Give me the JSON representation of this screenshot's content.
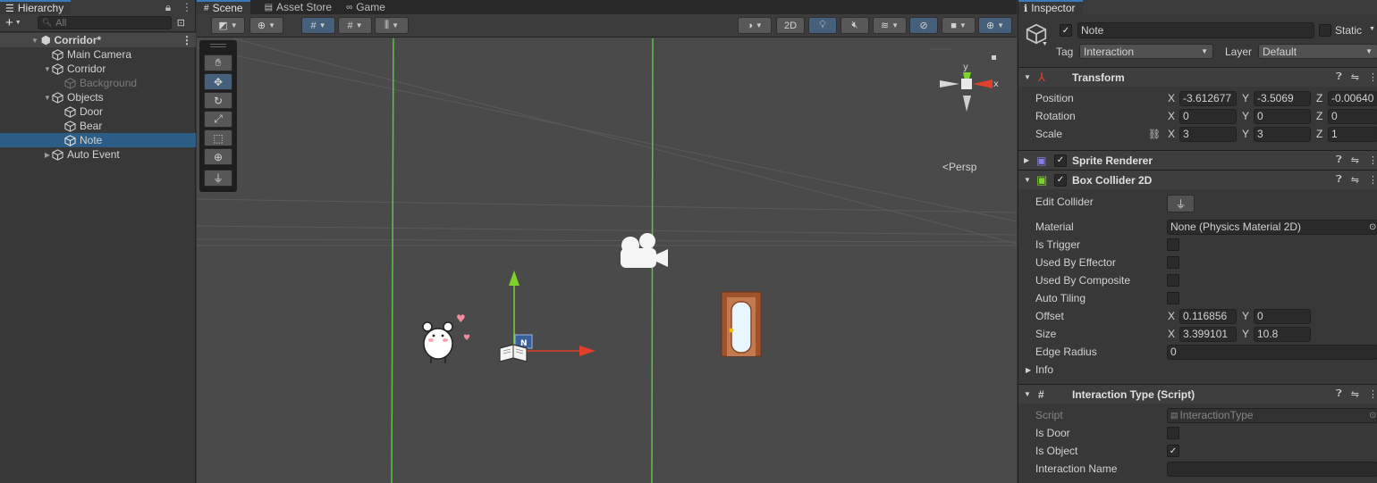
{
  "hierarchy": {
    "tab_label": "Hierarchy",
    "add_label": "+",
    "search_placeholder": "All",
    "scene_name": "Corridor*",
    "items": [
      {
        "label": "Main Camera",
        "depth": 1
      },
      {
        "label": "Corridor",
        "depth": 1
      },
      {
        "label": "Background",
        "depth": 2
      },
      {
        "label": "Objects",
        "depth": 1
      },
      {
        "label": "Door",
        "depth": 2
      },
      {
        "label": "Bear",
        "depth": 2
      },
      {
        "label": "Note",
        "depth": 2
      },
      {
        "label": "Auto Event",
        "depth": 1
      }
    ]
  },
  "scene": {
    "tabs": [
      "Scene",
      "Asset Store",
      "Game"
    ],
    "toolbar_2d": "2D",
    "persp_label": "Persp",
    "gizmo": {
      "x": "x",
      "y": "y"
    },
    "note_badge": "N"
  },
  "inspector": {
    "tab_label": "Inspector",
    "object_name": "Note",
    "static_label": "Static",
    "tag_label": "Tag",
    "tag_value": "Interaction",
    "layer_label": "Layer",
    "layer_value": "Default",
    "transform": {
      "title": "Transform",
      "position_label": "Position",
      "rotation_label": "Rotation",
      "scale_label": "Scale",
      "position": {
        "x": "-3.612677",
        "y": "-3.5069",
        "z": "-0.00640"
      },
      "rotation": {
        "x": "0",
        "y": "0",
        "z": "0"
      },
      "scale": {
        "x": "3",
        "y": "3",
        "z": "1"
      }
    },
    "sprite_renderer": {
      "title": "Sprite Renderer"
    },
    "box_collider": {
      "title": "Box Collider 2D",
      "edit_collider_label": "Edit Collider",
      "material_label": "Material",
      "material_value": "None (Physics Material 2D)",
      "is_trigger_label": "Is Trigger",
      "used_by_effector_label": "Used By Effector",
      "used_by_composite_label": "Used By Composite",
      "auto_tiling_label": "Auto Tiling",
      "offset_label": "Offset",
      "offset": {
        "x": "0.116856",
        "y": "0"
      },
      "size_label": "Size",
      "size": {
        "x": "3.399101",
        "y": "10.8"
      },
      "edge_radius_label": "Edge Radius",
      "edge_radius_value": "0",
      "info_label": "Info"
    },
    "interaction_type": {
      "title": "Interaction Type (Script)",
      "script_label": "Script",
      "script_value": "InteractionType",
      "is_door_label": "Is Door",
      "is_object_label": "Is Object",
      "is_object_checked": "✓",
      "interaction_name_label": "Interaction Name"
    },
    "axis_labels": {
      "x": "X",
      "y": "Y",
      "z": "Z"
    }
  },
  "colors": {
    "selection": "#2c5d87",
    "accent_tab": "#3a79bb",
    "scene_bg": "#4a4a4a",
    "grid_green": "#5ec24b",
    "axis_red": "#e0402a",
    "axis_green": "#7cd12a"
  }
}
